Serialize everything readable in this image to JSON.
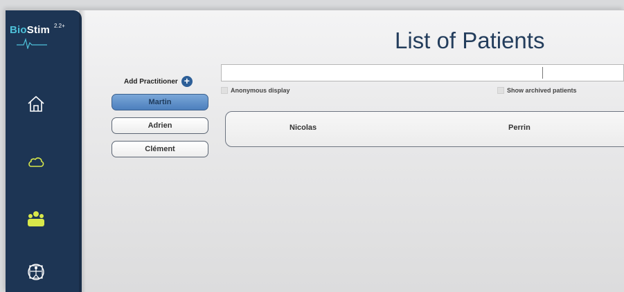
{
  "app": {
    "name_part1": "Bio",
    "name_part2": "Stim",
    "version": "2.2+"
  },
  "colors": {
    "sidebar": "#1d3554",
    "accent": "#4ec1d9",
    "active_button": "#5b8ac4",
    "patients_icon": "#d8e84a",
    "title": "#233d5c"
  },
  "icons": [
    "home-icon",
    "cloud-icon",
    "patients-icon",
    "vitruvian-body-icon"
  ],
  "page": {
    "title": "List of Patients"
  },
  "practitioners": {
    "add_label": "Add Practitioner",
    "items": [
      {
        "label": "Martin",
        "active": true
      },
      {
        "label": "Adrien",
        "active": false
      },
      {
        "label": "Clément",
        "active": false
      }
    ]
  },
  "search": {
    "value": "",
    "placeholder": ""
  },
  "options": {
    "anonymous_label": "Anonymous display",
    "archived_label": "Show archived patients"
  },
  "patients": [
    {
      "first_name": "Nicolas",
      "last_name": "Perrin"
    }
  ]
}
